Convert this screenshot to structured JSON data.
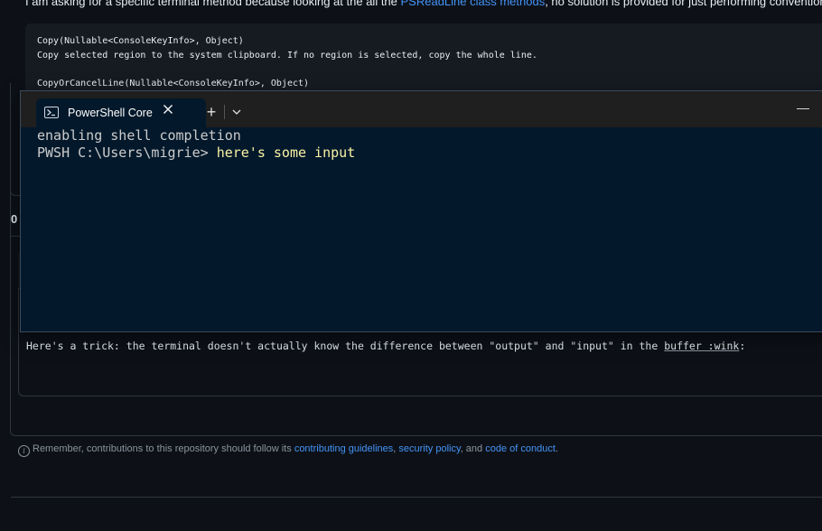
{
  "question": {
    "text_before_link": "I am asking for a specific terminal method because looking at the all the ",
    "link_text": "PSReadLine class methods",
    "text_after_link": ", no solution is provided for just performing conventional 'co"
  },
  "code_block": {
    "lines": [
      "Copy(Nullable<ConsoleKeyInfo>, Object)",
      "Copy selected region to the system clipboard. If no region is selected, copy the whole line.",
      "",
      "CopyOrCancelLine(Nullable<ConsoleKeyInfo>, Object)"
    ]
  },
  "count_label": "0",
  "comment_editor": {
    "text_before": "Here's a trick: the terminal doesn't actually know the difference between \"output\" and \"input\" in the ",
    "underlined_text": "buffer :wink",
    "text_after": ":"
  },
  "terminal": {
    "tab_title": "PowerShell Core",
    "tab_icon": "powershell-icon",
    "new_tab_symbol": "+",
    "minimize_symbol": "—",
    "line1": "enabling shell completion",
    "prompt": "PWSH C:\\Users\\migrie> ",
    "input": "here's some input"
  },
  "footer": {
    "text_before": "Remember, contributions to this repository should follow its ",
    "link1": "contributing guidelines",
    "sep1": ", ",
    "link2": "security policy",
    "sep2": ", and ",
    "link3": "code of conduct",
    "end": "."
  },
  "colors": {
    "page_bg": "#0d1117",
    "terminal_bg": "#03192b",
    "link": "#4493f8",
    "terminal_input": "#f9f1a5"
  }
}
